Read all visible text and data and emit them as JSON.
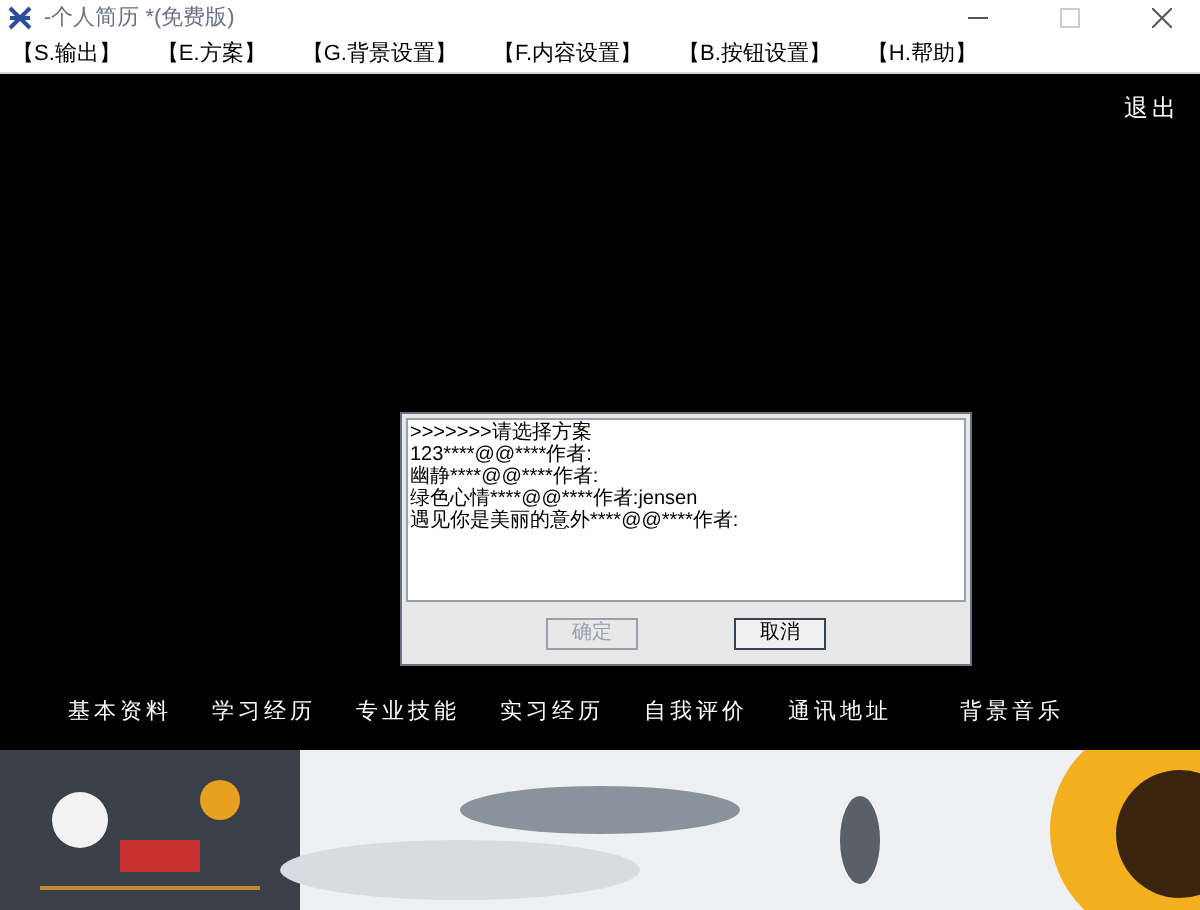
{
  "window": {
    "title": "-个人简历 *(免费版)",
    "maximize_disabled": true
  },
  "menu": [
    "【S.输出】",
    "【E.方案】",
    "【G.背景设置】",
    "【F.内容设置】",
    "【B.按钮设置】",
    "【H.帮助】"
  ],
  "exit_label": "退出",
  "dialog": {
    "prompt": ">>>>>>>请选择方案",
    "items": [
      {
        "text": "123****@@****作者:",
        "selected": false
      },
      {
        "text": "幽静****@@****作者:",
        "selected": false
      },
      {
        "text": "绿色心情****@@****作者:jensen",
        "selected": false
      },
      {
        "text": "遇见你是美丽的意外****@@****作者:",
        "selected": false
      }
    ],
    "buttons": [
      {
        "label": "确定",
        "disabled": true
      },
      {
        "label": "取消",
        "disabled": false
      }
    ]
  },
  "nav": [
    "基本资料",
    "学习经历",
    "专业技能",
    "实习经历",
    "自我评价",
    "通讯地址",
    "背景音乐"
  ],
  "banner": {
    "kind": "picture"
  }
}
